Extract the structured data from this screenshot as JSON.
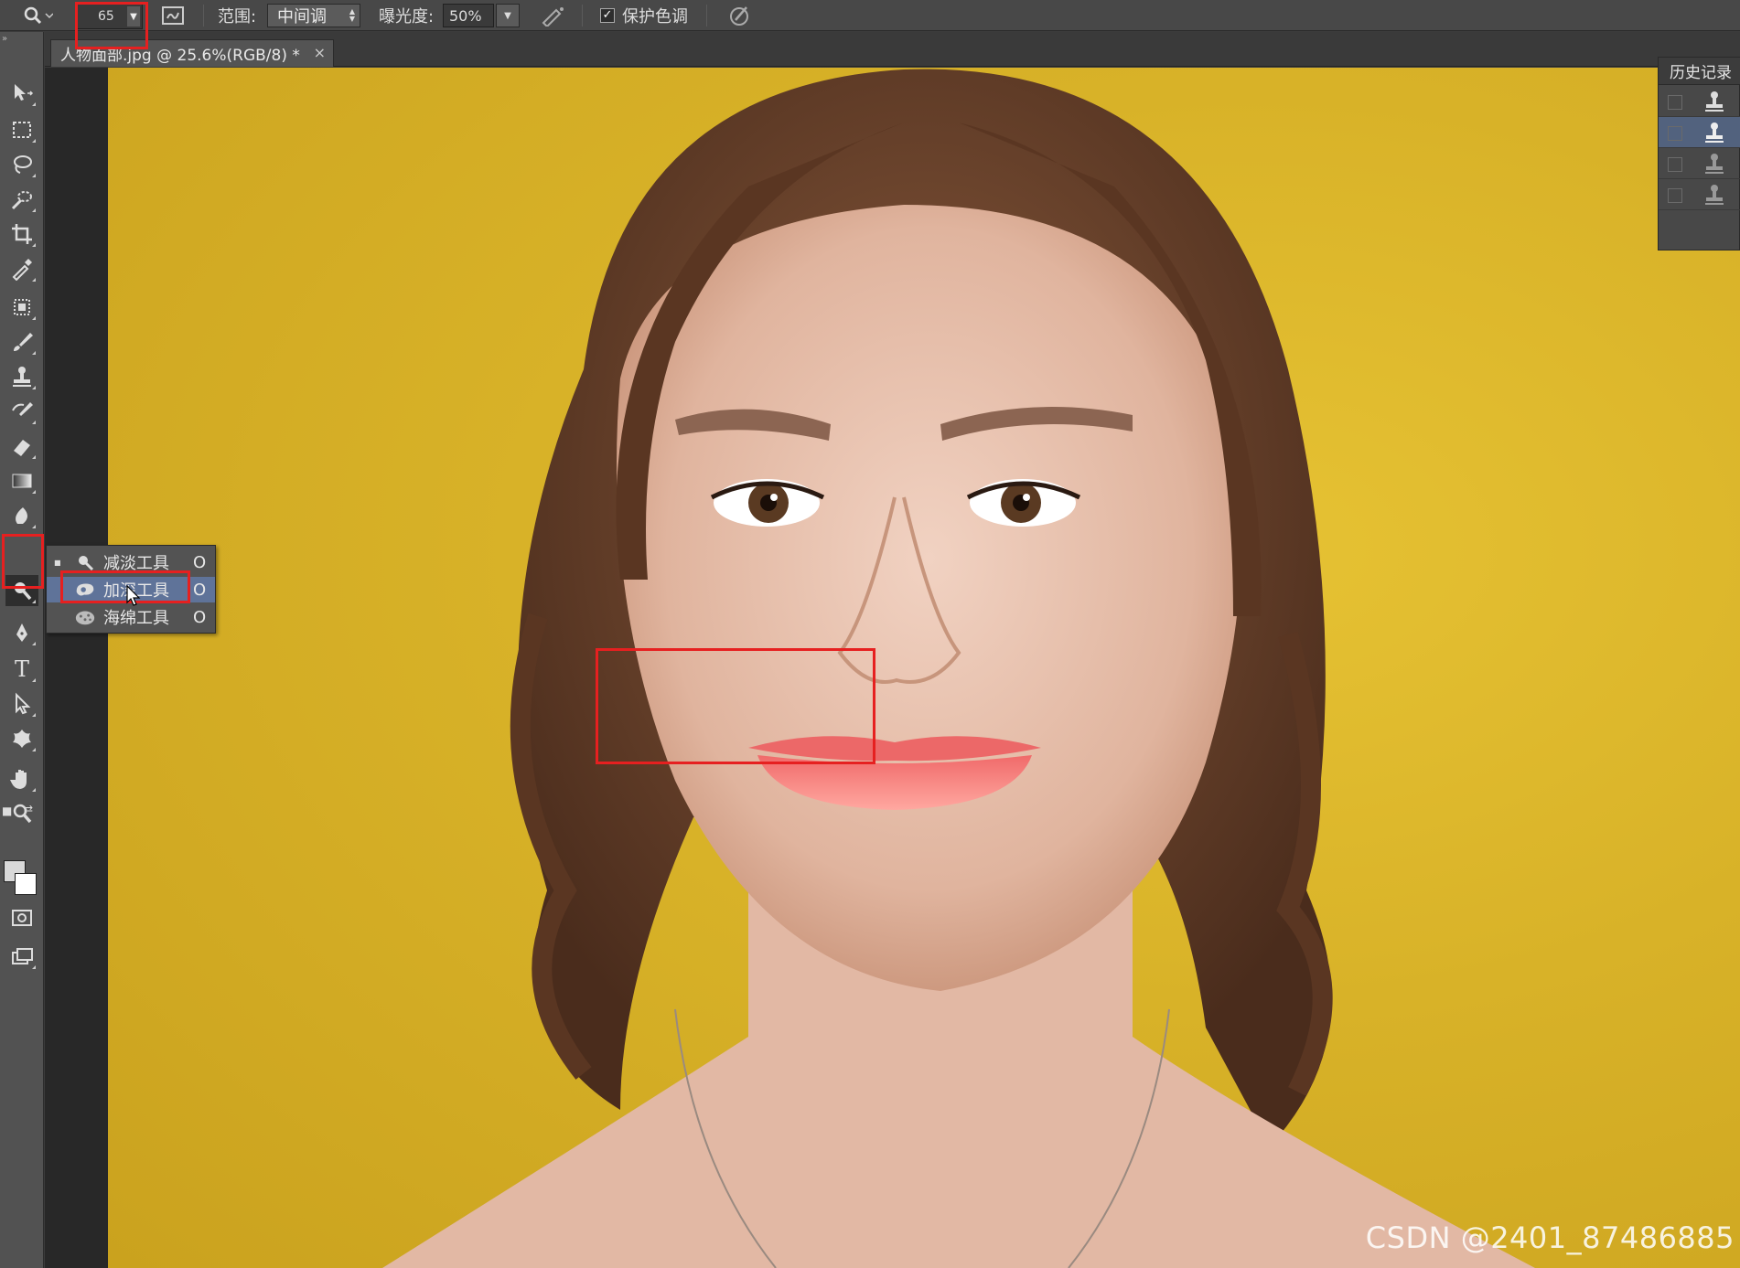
{
  "options_bar": {
    "brush_size": "65",
    "range_label": "范围:",
    "range_value": "中间调",
    "exposure_label": "曝光度:",
    "exposure_value": "50%",
    "protect_tones_label": "保护色调",
    "protect_tones_checked": "✓"
  },
  "document": {
    "tab_title": "人物面部.jpg @ 25.6%(RGB/8) *",
    "close_glyph": "×"
  },
  "tool_flyout": {
    "items": [
      {
        "label": "减淡工具",
        "shortcut": "O",
        "icon": "dodge-icon",
        "selected": false
      },
      {
        "label": "加深工具",
        "shortcut": "O",
        "icon": "burn-icon",
        "selected": true
      },
      {
        "label": "海绵工具",
        "shortcut": "O",
        "icon": "sponge-icon",
        "selected": false
      }
    ]
  },
  "history_panel": {
    "title": "历史记录",
    "rows": [
      {
        "icon": "clone-stamp-icon",
        "selected": false
      },
      {
        "icon": "clone-stamp-icon",
        "selected": true
      },
      {
        "icon": "clone-stamp-icon",
        "selected": false
      },
      {
        "icon": "clone-stamp-icon",
        "selected": false
      }
    ]
  },
  "toolbar": {
    "tools": [
      "move-icon",
      "marquee-icon",
      "lasso-icon",
      "quick-select-icon",
      "crop-icon",
      "eyedropper-icon",
      "healing-icon",
      "brush-icon",
      "clone-stamp-icon",
      "history-brush-icon",
      "eraser-icon",
      "gradient-icon",
      "blur-icon",
      "dodge-icon",
      "pen-icon",
      "type-icon",
      "path-select-icon",
      "custom-shape-icon",
      "hand-icon",
      "zoom-icon",
      "quick-mask-icon",
      "screen-mode-icon"
    ],
    "type_glyph": "T",
    "swap_glyph": "⇄"
  },
  "colors": {
    "accent": "#e62020",
    "canvas_bg": "#d8b228",
    "selection": "#5f7399"
  },
  "watermark": "CSDN @2401_87486885"
}
